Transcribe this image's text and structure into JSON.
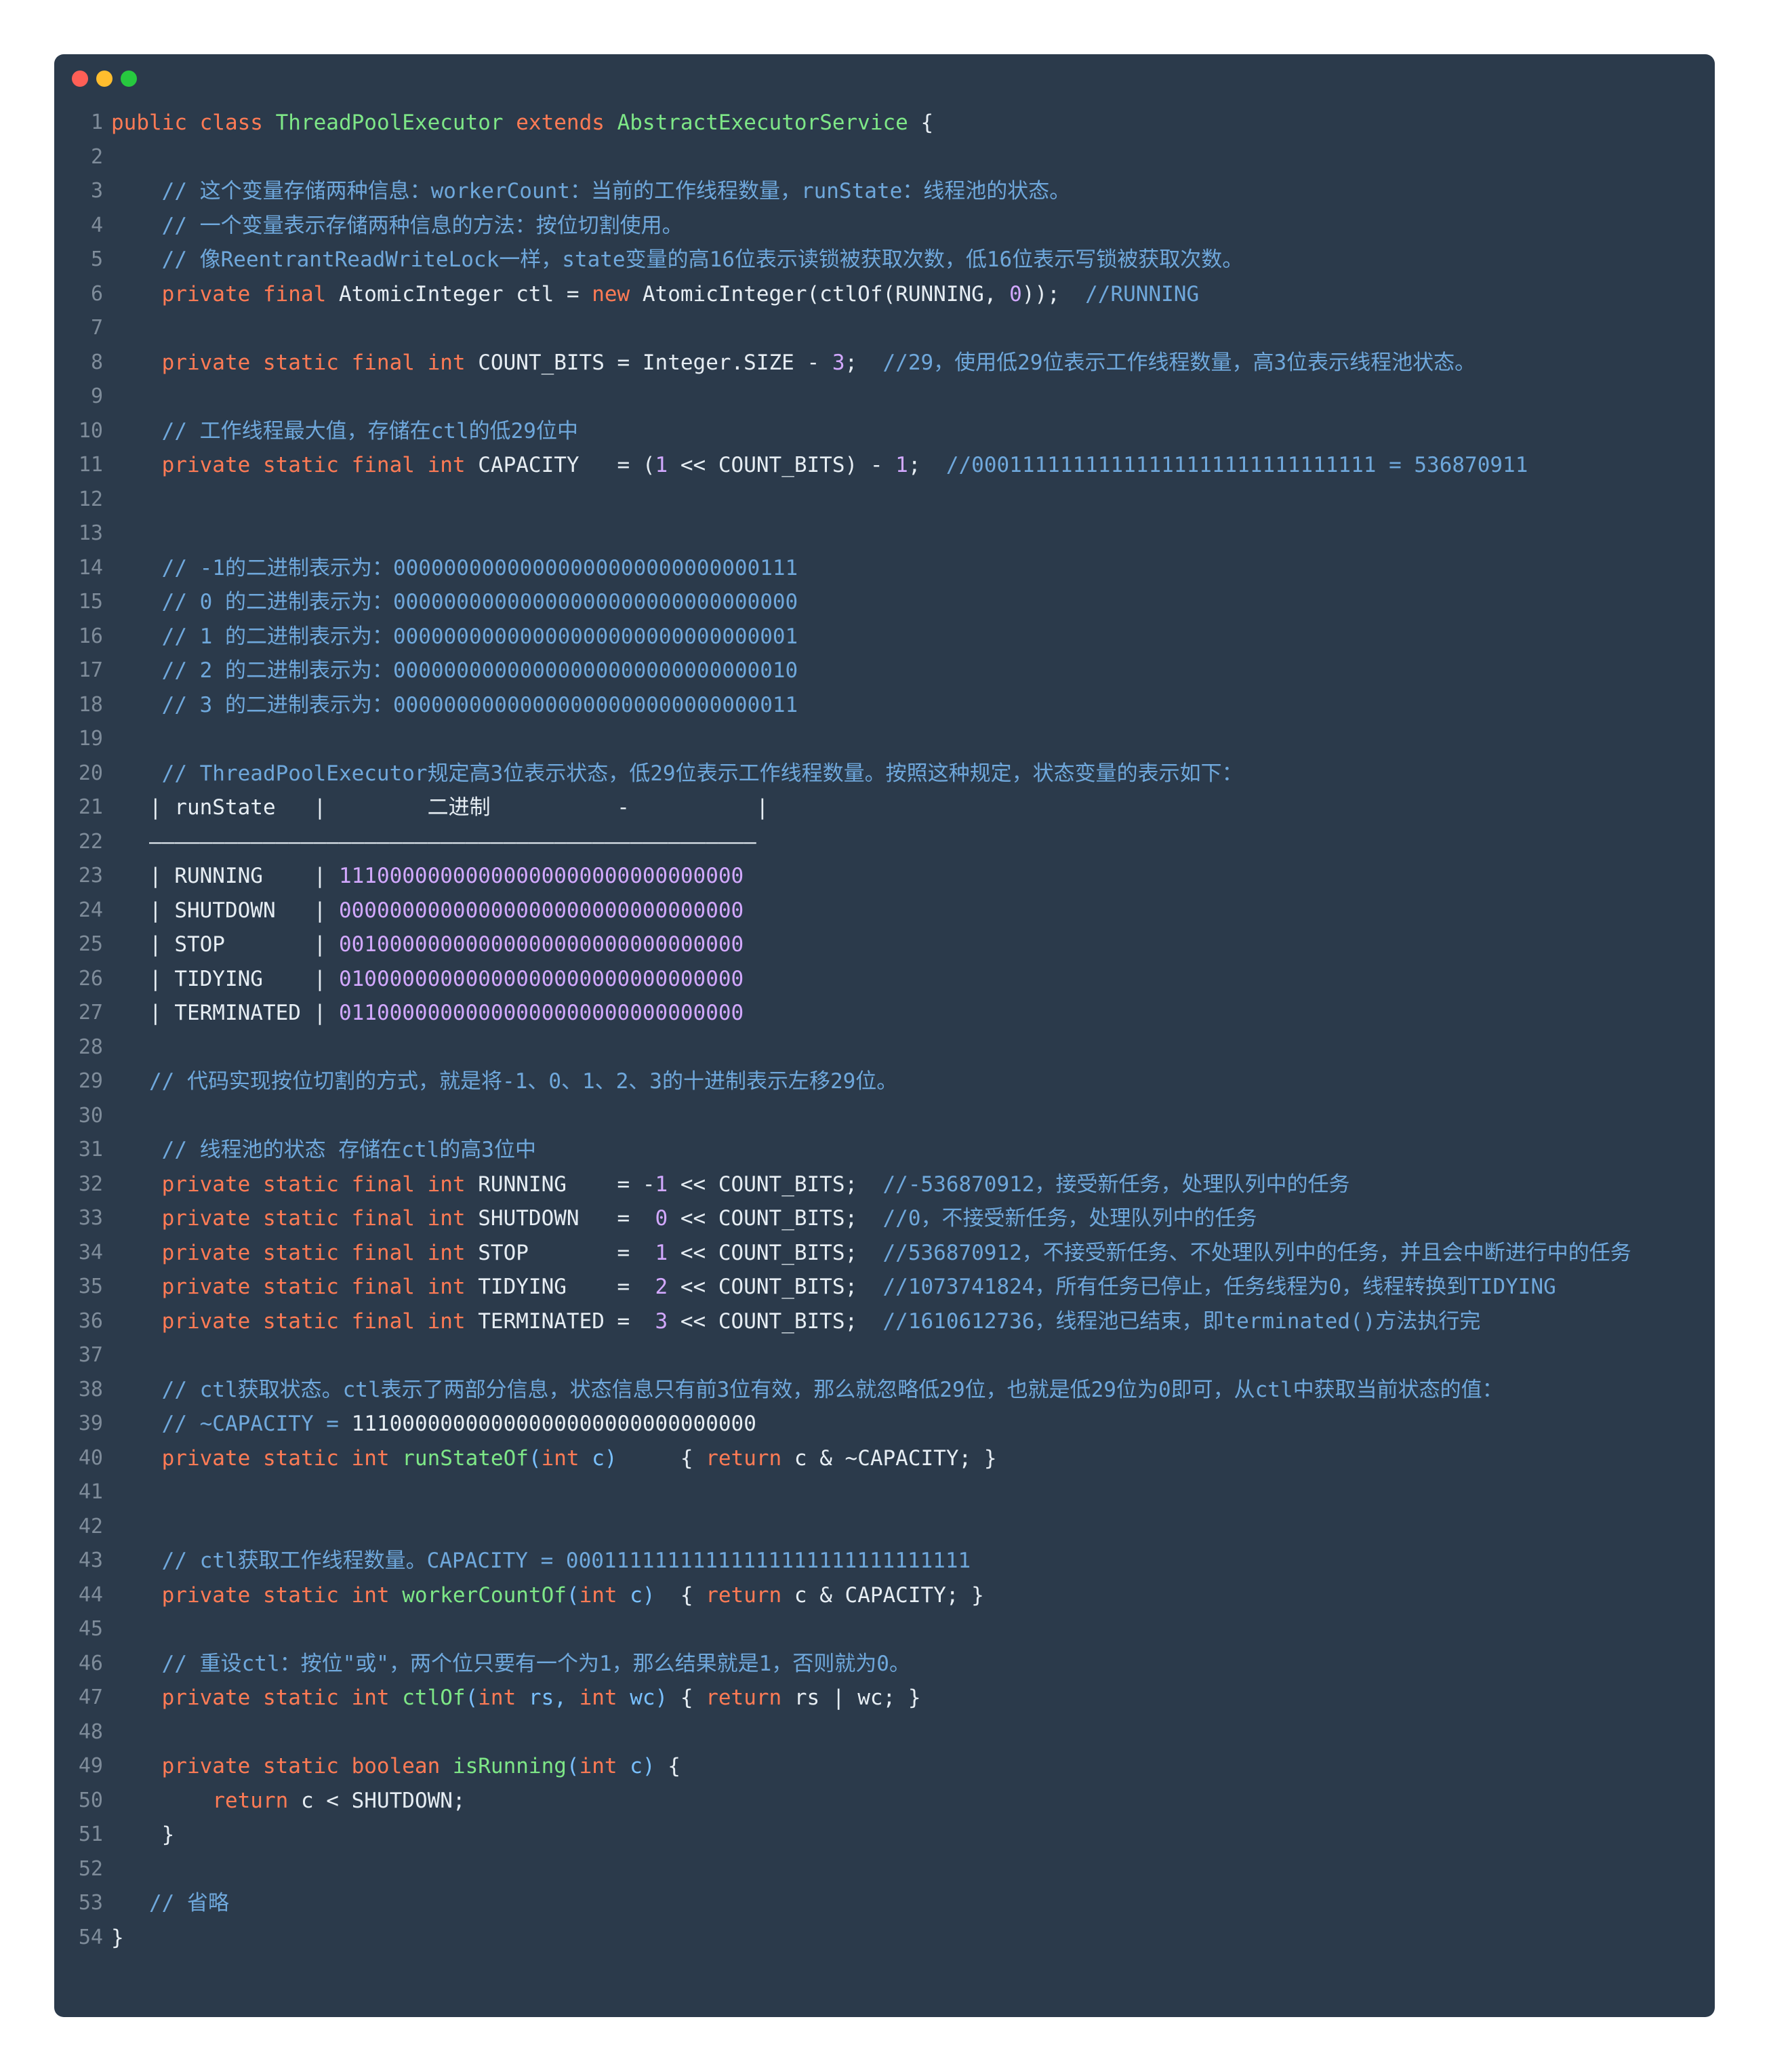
{
  "window": {
    "buttons": {
      "close_color": "#ff5f56",
      "minimize_color": "#ffbd2e",
      "maximize_color": "#27c93f"
    }
  },
  "code_lines": [
    {
      "n": "1",
      "segs": [
        [
          "kw",
          "public class "
        ],
        [
          "cls",
          "ThreadPoolExecutor"
        ],
        [
          "kw",
          " extends "
        ],
        [
          "cls",
          "AbstractExecutorService"
        ],
        [
          "plain",
          " {"
        ]
      ]
    },
    {
      "n": "2",
      "segs": []
    },
    {
      "n": "3",
      "segs": [
        [
          "plain",
          "    "
        ],
        [
          "cm",
          "// 这个变量存储两种信息：workerCount：当前的工作线程数量，runState：线程池的状态。"
        ]
      ]
    },
    {
      "n": "4",
      "segs": [
        [
          "plain",
          "    "
        ],
        [
          "cm",
          "// 一个变量表示存储两种信息的方法：按位切割使用。"
        ]
      ]
    },
    {
      "n": "5",
      "segs": [
        [
          "plain",
          "    "
        ],
        [
          "cm",
          "// 像ReentrantReadWriteLock一样，state变量的高16位表示读锁被获取次数，低16位表示写锁被获取次数。"
        ]
      ]
    },
    {
      "n": "6",
      "segs": [
        [
          "plain",
          "    "
        ],
        [
          "kw",
          "private final "
        ],
        [
          "plain",
          "AtomicInteger ctl = "
        ],
        [
          "kw",
          "new "
        ],
        [
          "plain",
          "AtomicInteger(ctlOf(RUNNING, "
        ],
        [
          "num",
          "0"
        ],
        [
          "plain",
          "));  "
        ],
        [
          "cm",
          "//RUNNING"
        ]
      ]
    },
    {
      "n": "7",
      "segs": []
    },
    {
      "n": "8",
      "segs": [
        [
          "plain",
          "    "
        ],
        [
          "kw",
          "private static final int "
        ],
        [
          "plain",
          "COUNT_BITS = Integer.SIZE - "
        ],
        [
          "num",
          "3"
        ],
        [
          "plain",
          ";  "
        ],
        [
          "cm",
          "//29，使用低29位表示工作线程数量，高3位表示线程池状态。"
        ]
      ]
    },
    {
      "n": "9",
      "segs": []
    },
    {
      "n": "10",
      "segs": [
        [
          "plain",
          "    "
        ],
        [
          "cm",
          "// 工作线程最大值，存储在ctl的低29位中"
        ]
      ]
    },
    {
      "n": "11",
      "segs": [
        [
          "plain",
          "    "
        ],
        [
          "kw",
          "private static final int "
        ],
        [
          "plain",
          "CAPACITY   = ("
        ],
        [
          "num",
          "1"
        ],
        [
          "plain",
          " << COUNT_BITS) - "
        ],
        [
          "num",
          "1"
        ],
        [
          "plain",
          ";  "
        ],
        [
          "cm",
          "//00011111111111111111111111111111 = 536870911"
        ]
      ]
    },
    {
      "n": "12",
      "segs": []
    },
    {
      "n": "13",
      "segs": []
    },
    {
      "n": "14",
      "segs": [
        [
          "plain",
          "    "
        ],
        [
          "cm",
          "// -1的二进制表示为：00000000000000000000000000000111"
        ]
      ]
    },
    {
      "n": "15",
      "segs": [
        [
          "plain",
          "    "
        ],
        [
          "cm",
          "// 0 的二进制表示为：00000000000000000000000000000000"
        ]
      ]
    },
    {
      "n": "16",
      "segs": [
        [
          "plain",
          "    "
        ],
        [
          "cm",
          "// 1 的二进制表示为：00000000000000000000000000000001"
        ]
      ]
    },
    {
      "n": "17",
      "segs": [
        [
          "plain",
          "    "
        ],
        [
          "cm",
          "// 2 的二进制表示为：00000000000000000000000000000010"
        ]
      ]
    },
    {
      "n": "18",
      "segs": [
        [
          "plain",
          "    "
        ],
        [
          "cm",
          "// 3 的二进制表示为：00000000000000000000000000000011"
        ]
      ]
    },
    {
      "n": "19",
      "segs": []
    },
    {
      "n": "20",
      "segs": [
        [
          "plain",
          "    "
        ],
        [
          "cm",
          "// ThreadPoolExecutor规定高3位表示状态，低29位表示工作线程数量。按照这种规定，状态变量的表示如下："
        ]
      ]
    },
    {
      "n": "21",
      "segs": [
        [
          "plain",
          "   | runState   |        二进制          -          |"
        ]
      ]
    },
    {
      "n": "22",
      "segs": [
        [
          "plain",
          "   ————————————————————————————————————————————————"
        ]
      ]
    },
    {
      "n": "23",
      "segs": [
        [
          "plain",
          "   | RUNNING    | "
        ],
        [
          "purple",
          "11100000000000000000000000000000"
        ]
      ]
    },
    {
      "n": "24",
      "segs": [
        [
          "plain",
          "   | SHUTDOWN   | "
        ],
        [
          "purple",
          "00000000000000000000000000000000"
        ]
      ]
    },
    {
      "n": "25",
      "segs": [
        [
          "plain",
          "   | STOP       | "
        ],
        [
          "purple",
          "00100000000000000000000000000000"
        ]
      ]
    },
    {
      "n": "26",
      "segs": [
        [
          "plain",
          "   | TIDYING    | "
        ],
        [
          "purple",
          "01000000000000000000000000000000"
        ]
      ]
    },
    {
      "n": "27",
      "segs": [
        [
          "plain",
          "   | TERMINATED | "
        ],
        [
          "purple",
          "01100000000000000000000000000000"
        ]
      ]
    },
    {
      "n": "28",
      "segs": []
    },
    {
      "n": "29",
      "segs": [
        [
          "plain",
          "   "
        ],
        [
          "cm",
          "// 代码实现按位切割的方式，就是将-1、0、1、2、3的十进制表示左移29位。"
        ]
      ]
    },
    {
      "n": "30",
      "segs": []
    },
    {
      "n": "31",
      "segs": [
        [
          "plain",
          "    "
        ],
        [
          "cm",
          "// 线程池的状态 存储在ctl的高3位中"
        ]
      ]
    },
    {
      "n": "32",
      "segs": [
        [
          "plain",
          "    "
        ],
        [
          "kw",
          "private static final int "
        ],
        [
          "plain",
          "RUNNING    = -"
        ],
        [
          "num",
          "1"
        ],
        [
          "plain",
          " << COUNT_BITS;  "
        ],
        [
          "cm",
          "//-536870912，接受新任务，处理队列中的任务"
        ]
      ]
    },
    {
      "n": "33",
      "segs": [
        [
          "plain",
          "    "
        ],
        [
          "kw",
          "private static final int "
        ],
        [
          "plain",
          "SHUTDOWN   =  "
        ],
        [
          "num",
          "0"
        ],
        [
          "plain",
          " << COUNT_BITS;  "
        ],
        [
          "cm",
          "//0，不接受新任务，处理队列中的任务"
        ]
      ]
    },
    {
      "n": "34",
      "segs": [
        [
          "plain",
          "    "
        ],
        [
          "kw",
          "private static final int "
        ],
        [
          "plain",
          "STOP       =  "
        ],
        [
          "num",
          "1"
        ],
        [
          "plain",
          " << COUNT_BITS;  "
        ],
        [
          "cm",
          "//536870912，不接受新任务、不处理队列中的任务，并且会中断进行中的任务"
        ]
      ]
    },
    {
      "n": "35",
      "segs": [
        [
          "plain",
          "    "
        ],
        [
          "kw",
          "private static final int "
        ],
        [
          "plain",
          "TIDYING    =  "
        ],
        [
          "num",
          "2"
        ],
        [
          "plain",
          " << COUNT_BITS;  "
        ],
        [
          "cm",
          "//1073741824，所有任务已停止，任务线程为0，线程转换到TIDYING"
        ]
      ]
    },
    {
      "n": "36",
      "segs": [
        [
          "plain",
          "    "
        ],
        [
          "kw",
          "private static final int "
        ],
        [
          "plain",
          "TERMINATED =  "
        ],
        [
          "num",
          "3"
        ],
        [
          "plain",
          " << COUNT_BITS;  "
        ],
        [
          "cm",
          "//1610612736，线程池已结束，即terminated()方法执行完"
        ]
      ]
    },
    {
      "n": "37",
      "segs": []
    },
    {
      "n": "38",
      "segs": [
        [
          "plain",
          "    "
        ],
        [
          "cm",
          "// ctl获取状态。ctl表示了两部分信息，状态信息只有前3位有效，那么就忽略低29位，也就是低29位为0即可，从ctl中获取当前状态的值："
        ]
      ]
    },
    {
      "n": "39",
      "segs": [
        [
          "plain",
          "    "
        ],
        [
          "cm",
          "// ~CAPACITY = "
        ],
        [
          "plain",
          "11100000000000000000000000000000"
        ]
      ]
    },
    {
      "n": "40",
      "segs": [
        [
          "plain",
          "    "
        ],
        [
          "kw",
          "private static int "
        ],
        [
          "fn",
          "runStateOf"
        ],
        [
          "param",
          "("
        ],
        [
          "kw",
          "int "
        ],
        [
          "param",
          "c)"
        ],
        [
          "plain",
          "     { "
        ],
        [
          "kw",
          "return "
        ],
        [
          "plain",
          "c & ~CAPACITY; }"
        ]
      ]
    },
    {
      "n": "41",
      "segs": []
    },
    {
      "n": "42",
      "segs": []
    },
    {
      "n": "43",
      "segs": [
        [
          "plain",
          "    "
        ],
        [
          "cm",
          "// ctl获取工作线程数量。CAPACITY = 00011111111111111111111111111111"
        ]
      ]
    },
    {
      "n": "44",
      "segs": [
        [
          "plain",
          "    "
        ],
        [
          "kw",
          "private static int "
        ],
        [
          "fn",
          "workerCountOf"
        ],
        [
          "param",
          "("
        ],
        [
          "kw",
          "int "
        ],
        [
          "param",
          "c)"
        ],
        [
          "plain",
          "  { "
        ],
        [
          "kw",
          "return "
        ],
        [
          "plain",
          "c & CAPACITY; }"
        ]
      ]
    },
    {
      "n": "45",
      "segs": []
    },
    {
      "n": "46",
      "segs": [
        [
          "plain",
          "    "
        ],
        [
          "cm",
          "// 重设ctl：按位\"或\"，两个位只要有一个为1，那么结果就是1，否则就为0。"
        ]
      ]
    },
    {
      "n": "47",
      "segs": [
        [
          "plain",
          "    "
        ],
        [
          "kw",
          "private static int "
        ],
        [
          "fn",
          "ctlOf"
        ],
        [
          "param",
          "("
        ],
        [
          "kw",
          "int "
        ],
        [
          "param",
          "rs, "
        ],
        [
          "kw",
          "int "
        ],
        [
          "param",
          "wc)"
        ],
        [
          "plain",
          " { "
        ],
        [
          "kw",
          "return "
        ],
        [
          "plain",
          "rs | wc; }"
        ]
      ]
    },
    {
      "n": "48",
      "segs": []
    },
    {
      "n": "49",
      "segs": [
        [
          "plain",
          "    "
        ],
        [
          "kw",
          "private static boolean "
        ],
        [
          "fn",
          "isRunning"
        ],
        [
          "param",
          "("
        ],
        [
          "kw",
          "int "
        ],
        [
          "param",
          "c)"
        ],
        [
          "plain",
          " {"
        ]
      ]
    },
    {
      "n": "50",
      "segs": [
        [
          "plain",
          "        "
        ],
        [
          "kw",
          "return "
        ],
        [
          "plain",
          "c < SHUTDOWN;"
        ]
      ]
    },
    {
      "n": "51",
      "segs": [
        [
          "plain",
          "    }"
        ]
      ]
    },
    {
      "n": "52",
      "segs": []
    },
    {
      "n": "53",
      "segs": [
        [
          "plain",
          "   "
        ],
        [
          "cm",
          "// 省略"
        ]
      ]
    },
    {
      "n": "54",
      "segs": [
        [
          "plain",
          "}"
        ]
      ]
    }
  ]
}
